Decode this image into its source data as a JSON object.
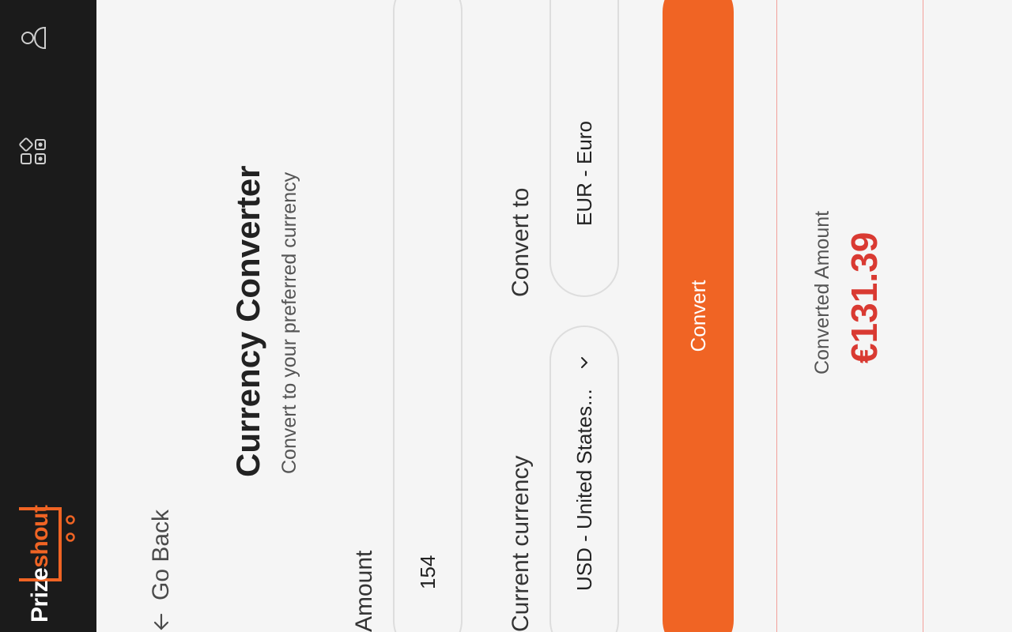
{
  "app": {
    "logo_main": "Prize",
    "logo_accent": "shout"
  },
  "nav": {
    "back_label": "Go Back"
  },
  "page": {
    "title": "Currency Converter",
    "subtitle": "Convert to your preferred currency"
  },
  "form": {
    "amount_label": "Amount",
    "amount_value": "154",
    "current_currency_label": "Current currency",
    "current_currency_value": "USD - United States...",
    "convert_to_label": "Convert to",
    "convert_to_value": "EUR - Euro",
    "convert_button": "Convert"
  },
  "result": {
    "label": "Converted Amount",
    "value": "€131.39"
  },
  "colors": {
    "accent": "#f06424",
    "sidebar": "#1b1b1b",
    "result_value": "#d93a32",
    "background": "#f5f5f5"
  },
  "icons": {
    "apps": "apps-icon",
    "user": "user-icon",
    "back": "arrow-left-icon",
    "chevron": "chevron-down-icon"
  }
}
